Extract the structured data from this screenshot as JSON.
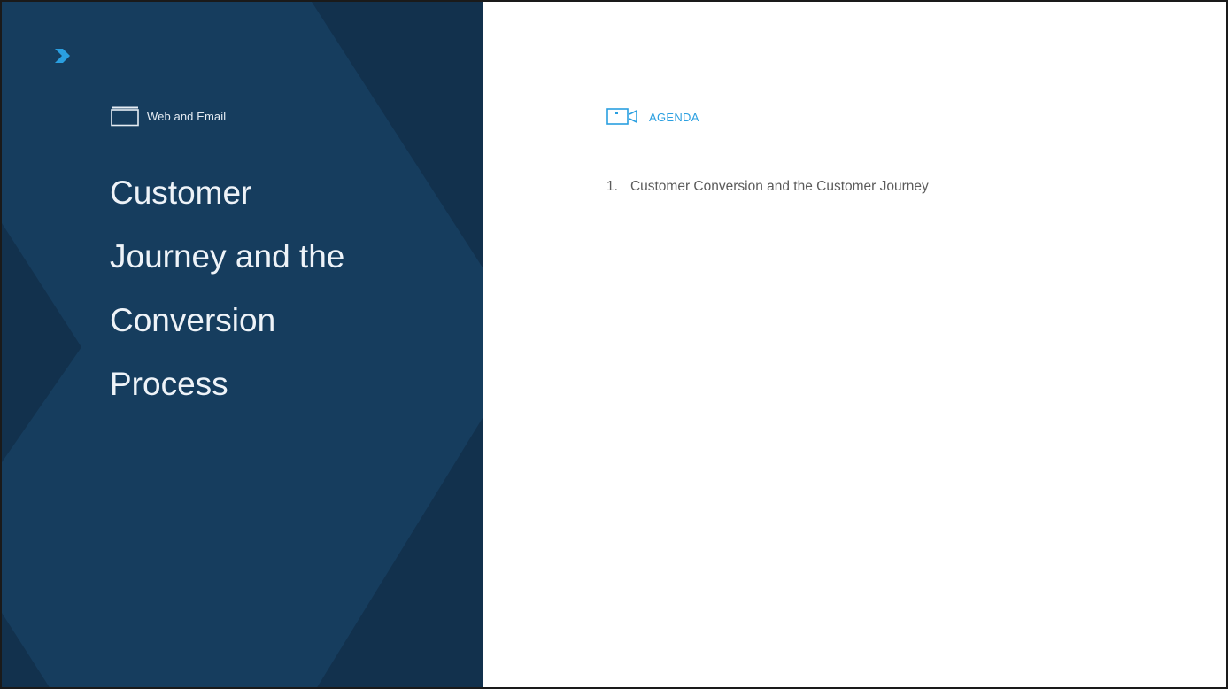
{
  "slide": {
    "section_tag": "Web and Email",
    "title": "Customer\nJourney and the\nConversion\nProcess",
    "agenda": {
      "heading": "AGENDA",
      "items": [
        {
          "number": "1.",
          "text": "Customer Conversion and the Customer Journey"
        }
      ]
    }
  },
  "icons": {
    "brand": "chevron-right-icon",
    "section": "folder-tab-icon",
    "agenda": "video-camera-icon"
  },
  "colors": {
    "panel_bg": "#163d5e",
    "panel_shade": "#12314d",
    "accent": "#2a9fe0",
    "title_text": "#eef3f8",
    "agenda_text": "#5b5b5b"
  }
}
